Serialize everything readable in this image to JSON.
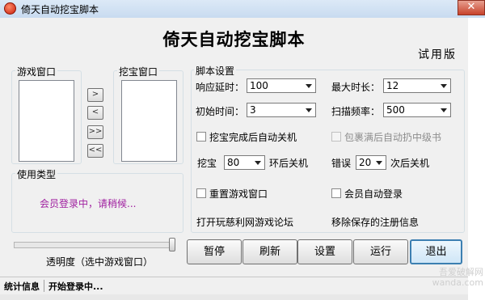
{
  "window": {
    "title": "倚天自动挖宝脚本",
    "close_symbol": "✕",
    "heading": "倚天自动挖宝脚本",
    "edition": "试用版"
  },
  "game_window_group": {
    "label": "游戏窗口"
  },
  "dig_window_group": {
    "label": "挖宝窗口"
  },
  "transfer_buttons": {
    "move_right": ">",
    "move_left": "<",
    "move_all_right": ">>",
    "move_all_left": "<<"
  },
  "usage_group": {
    "label": "使用类型",
    "message": "会员登录中，请稍候...",
    "message_color": "#a020a0"
  },
  "settings": {
    "label": "脚本设置",
    "response_delay": {
      "label": "响应延时：",
      "value": "100"
    },
    "max_duration": {
      "label": "最大时长：",
      "value": "12"
    },
    "initial_time": {
      "label": "初始时间：",
      "value": "3"
    },
    "scan_frequency": {
      "label": "扫描频率：",
      "value": "500"
    },
    "shutdown_after_dig": {
      "label": "挖宝完成后自动关机",
      "checked": false,
      "enabled": true
    },
    "throw_items_when_full": {
      "label": "包裹满后自动扔中级书",
      "checked": false,
      "enabled": false
    },
    "dig_rounds": {
      "prefix": "挖宝",
      "value": "80",
      "suffix": "环后关机"
    },
    "error_count": {
      "prefix": "错误",
      "value": "20",
      "suffix": "次后关机"
    },
    "reset_game_window": {
      "label": "重置游戏窗口",
      "checked": false
    },
    "member_auto_login": {
      "label": "会员自动登录",
      "checked": false
    },
    "forum_link": "打开玩慈利网游戏论坛",
    "remove_registration": "移除保存的注册信息"
  },
  "transparency": {
    "caption": "透明度（选中游戏窗口）",
    "level_percent": 100
  },
  "buttons": {
    "pause": "暂停",
    "refresh": "刷新",
    "settings": "设置",
    "run": "运行",
    "exit": "退出"
  },
  "statusbar": {
    "section_label": "统计信息",
    "message": "开始登录中..."
  },
  "watermark": {
    "line1": "吾爱破解网",
    "line2": "wanda.com"
  }
}
